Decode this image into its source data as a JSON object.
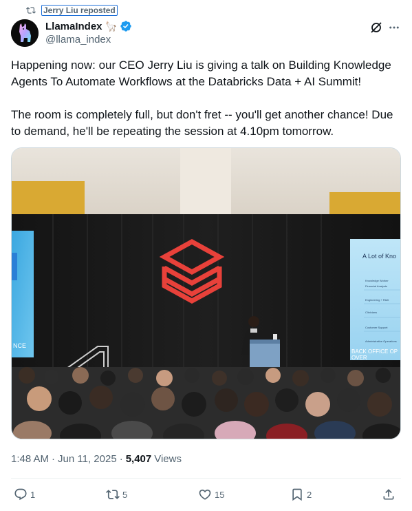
{
  "repost": {
    "icon": "repost-icon",
    "label": "Jerry Liu reposted"
  },
  "author": {
    "display_name": "LlamaIndex",
    "emoji": "🦙",
    "handle": "@llama_index",
    "verified_icon": "verified-badge-icon",
    "avatar_icon": "llama-logo-avatar"
  },
  "header_icons": {
    "grok": "grok-icon",
    "more": "more-icon"
  },
  "tweet": {
    "paragraph_1": "Happening now: our CEO Jerry Liu is giving a talk on Building Knowledge Agents To Automate Workflows at the Databricks Data + AI Summit!",
    "paragraph_2": "The room is completely full, but don't fret -- you'll get another chance! Due to demand, he'll be repeating the session at 4.10pm tomorrow."
  },
  "media": {
    "screen_right_title": "A Lot of Kno",
    "screen_right_rows": [
      "Knowledge Worker",
      "Financial Analysts",
      "Engineering + R&D",
      "Clinicians",
      "Customer Support",
      "Administrative Operations"
    ],
    "screen_right_footer": "BACK OFFICE OP",
    "screen_right_footer_2": "OVER",
    "screen_left_text": "NCE"
  },
  "meta": {
    "time": "1:48 AM",
    "separator": "·",
    "date": "Jun 11, 2025",
    "views_count": "5,407",
    "views_label": "Views"
  },
  "actions": {
    "reply": {
      "icon": "reply-icon",
      "count": "1"
    },
    "repost": {
      "icon": "repost-icon",
      "count": "5"
    },
    "like": {
      "icon": "heart-icon",
      "count": "15"
    },
    "bookmark": {
      "icon": "bookmark-icon",
      "count": "2"
    },
    "share": {
      "icon": "share-icon"
    }
  },
  "colors": {
    "text_primary": "#0f1419",
    "text_secondary": "#536471",
    "verified_blue": "#1d9bf0",
    "databricks_red": "#e8413a"
  }
}
